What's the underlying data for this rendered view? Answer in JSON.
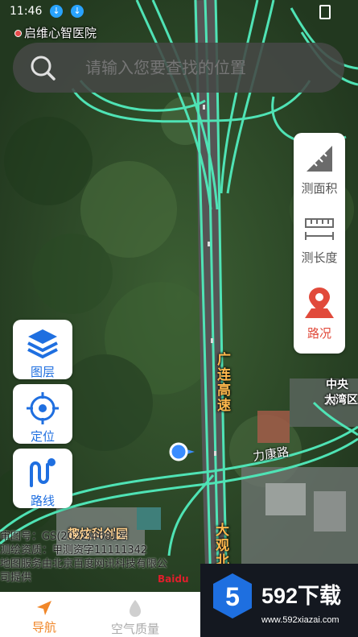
{
  "status_bar": {
    "time": "11:46"
  },
  "map": {
    "top_poi": "启维心智医院",
    "labels": {
      "park": "趣炫科创园",
      "right_poi_1": "中央财",
      "right_poi_2": "大湾区",
      "road": "力康路",
      "highway_1": "广连高速",
      "highway_2": "大观北"
    },
    "colors": {
      "road_glow": "#4fe3b5",
      "forest": "#2d4a2a"
    }
  },
  "search": {
    "placeholder": "请输入您要查找的位置",
    "icon": "search-icon"
  },
  "right_tools": [
    {
      "label": "测面积",
      "icon": "ruler-icon"
    },
    {
      "label": "测长度",
      "icon": "measure-length-icon"
    },
    {
      "label": "路况",
      "icon": "traffic-icon"
    }
  ],
  "left_tools": [
    {
      "label": "图层",
      "icon": "layers-icon"
    },
    {
      "label": "定位",
      "icon": "locate-icon"
    },
    {
      "label": "路线",
      "icon": "route-icon"
    }
  ],
  "copyright": {
    "line1": "审图号：GS(2022)4681号",
    "line2": "测绘资质：甲测资字11111342",
    "line3": "地图服务由北京百度网讯科技有限公",
    "line4": "司提供",
    "logo": "Baidu"
  },
  "tabs": [
    {
      "label": "导航",
      "active": true,
      "icon": "navigation-arrow-icon"
    },
    {
      "label": "空气质量",
      "active": false,
      "icon": "air-quality-icon"
    }
  ],
  "watermark": {
    "title": "592下载",
    "url": "www.592xiazai.com"
  }
}
